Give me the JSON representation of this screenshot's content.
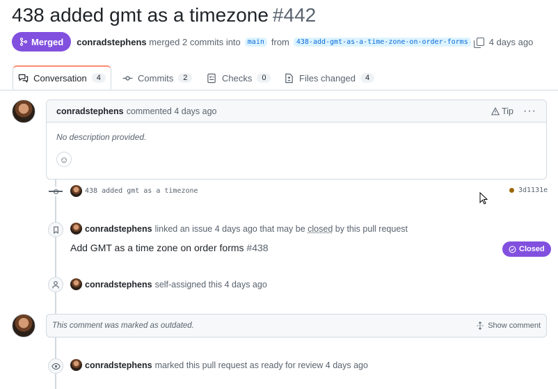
{
  "pr": {
    "title": "438 added gmt as a timezone",
    "number": "#442",
    "state": "Merged",
    "author": "conradstephens",
    "merge_text": "merged 2 commits into",
    "base_branch": "main",
    "from_text": "from",
    "head_branch": "438-add-gmt-as-a-time-zone-on-order-forms",
    "time": "4 days ago"
  },
  "tabs": [
    {
      "label": "Conversation",
      "count": "4",
      "icon": "comment-discussion-icon"
    },
    {
      "label": "Commits",
      "count": "2",
      "icon": "git-commit-icon"
    },
    {
      "label": "Checks",
      "count": "0",
      "icon": "checklist-icon"
    },
    {
      "label": "Files changed",
      "count": "4",
      "icon": "file-diff-icon"
    }
  ],
  "comment": {
    "author": "conradstephens",
    "action": "commented 4 days ago",
    "tip_label": "Tip",
    "body": "No description provided."
  },
  "commit": {
    "message": "438 added gmt as a timezone",
    "sha": "3d1131e",
    "status_color": "#9a6700"
  },
  "linked": {
    "author": "conradstephens",
    "text": "linked an issue 4 days ago that may be",
    "closed_word": "closed",
    "text_after": "by this pull request",
    "issue_title": "Add GMT as a time zone on order forms",
    "issue_number": "#438",
    "badge": "Closed"
  },
  "assigned": {
    "author": "conradstephens",
    "text": "self-assigned this 4 days ago"
  },
  "outdated": {
    "text": "This comment was marked as outdated.",
    "show_label": "Show comment"
  },
  "ready": {
    "author": "conradstephens",
    "text": "marked this pull request as ready for review 4 days ago"
  },
  "colors": {
    "merged": "#8250df",
    "accent": "#0969da",
    "tab_underline": "#fd8c73"
  }
}
